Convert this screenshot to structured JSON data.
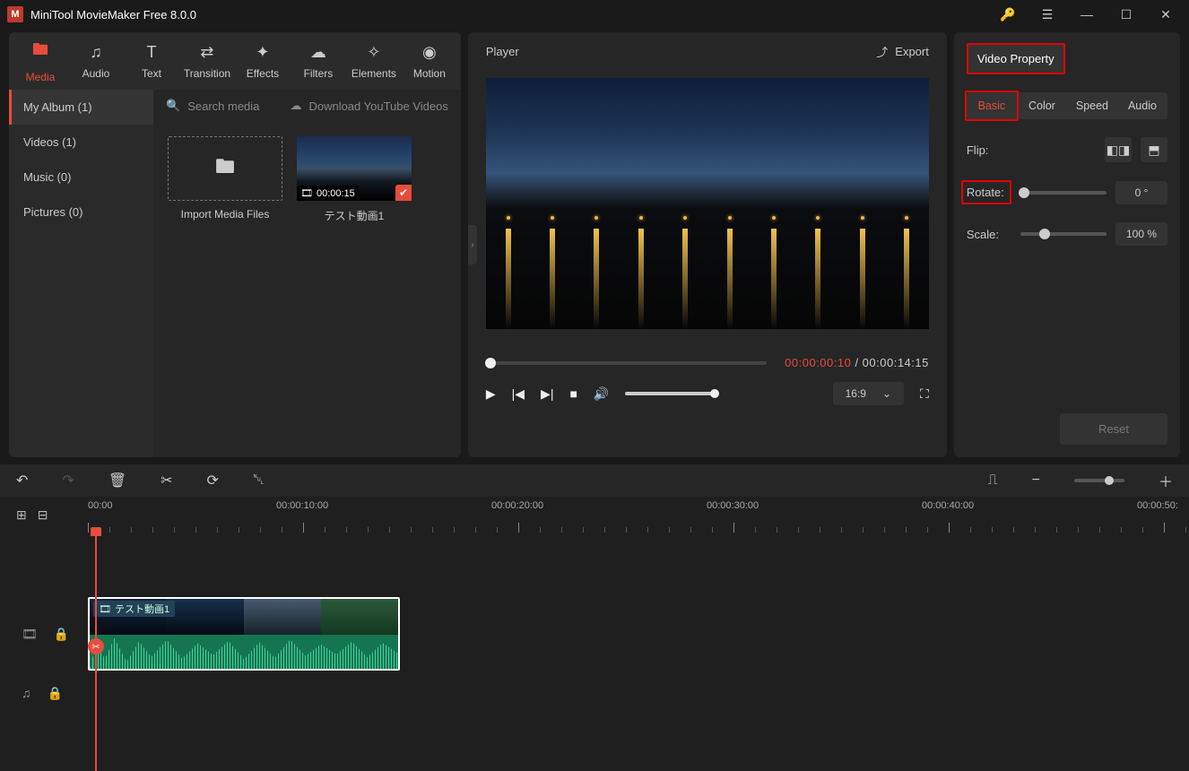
{
  "title": "MiniTool MovieMaker Free 8.0.0",
  "tabs": {
    "media": "Media",
    "audio": "Audio",
    "text": "Text",
    "transition": "Transition",
    "effects": "Effects",
    "filters": "Filters",
    "elements": "Elements",
    "motion": "Motion"
  },
  "sidebar": {
    "album": "My Album (1)",
    "videos": "Videos (1)",
    "music": "Music (0)",
    "pictures": "Pictures (0)"
  },
  "search": {
    "placeholder": "Search media",
    "download": "Download YouTube Videos"
  },
  "import": {
    "label": "Import Media Files"
  },
  "clip1": {
    "duration": "00:00:15",
    "name": "テスト動画1"
  },
  "player": {
    "label": "Player",
    "export": "Export",
    "cur": "00:00:00:10",
    "sep": " / ",
    "total": "00:00:14:15",
    "aspect": "16:9"
  },
  "vp": {
    "title": "Video Property",
    "tabs": {
      "basic": "Basic",
      "color": "Color",
      "speed": "Speed",
      "audio": "Audio"
    },
    "flip": "Flip:",
    "rotate": "Rotate:",
    "scale": "Scale:",
    "rotate_val": "0 °",
    "scale_val": "100 %",
    "reset": "Reset"
  },
  "ruler": {
    "t0": "00:00",
    "t1": "00:00:10:00",
    "t2": "00:00:20:00",
    "t3": "00:00:30:00",
    "t4": "00:00:40:00",
    "t5": "00:00:50:"
  },
  "timeline_clip": "テスト動画1"
}
